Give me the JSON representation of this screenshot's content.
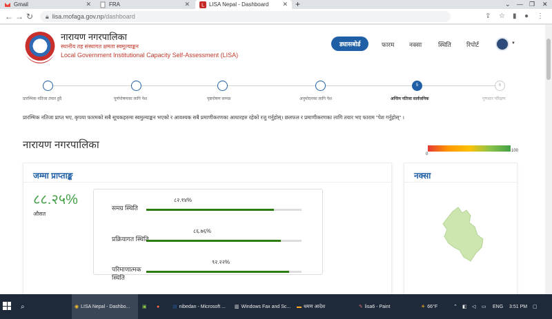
{
  "browser": {
    "tabs": [
      {
        "label": "Gmail",
        "icon": "gmail-icon",
        "active": false
      },
      {
        "label": "FRA",
        "icon": "document-icon",
        "active": false
      },
      {
        "label": "LISA Nepal - Dashboard",
        "icon": "lisa-icon",
        "active": true
      }
    ],
    "new_tab": "+",
    "url_host": "lisa.mofaga.gov.np",
    "url_path": "/dashboard"
  },
  "header": {
    "org_name": "नारायण नगरपालिका",
    "subtitle_np": "स्थानीय तह संस्थागत क्षमता स्वमूल्याङ्कन",
    "subtitle_en": "Local Government Institutional Capacity Self-Assessment (LISA)",
    "menu": {
      "dashboard": "ड्यासबोर्ड",
      "forms": "फारम",
      "map": "नक्सा",
      "status": "स्थिति",
      "report": "रिपोर्ट"
    }
  },
  "stepper": {
    "steps": [
      {
        "label": "प्रारम्भिक नतिजा तयार हुदै",
        "number": ""
      },
      {
        "label": "पूर्णपोषणका लागि पेश",
        "number": ""
      },
      {
        "label": "पृष्ठपोषण सम्पन्न",
        "number": ""
      },
      {
        "label": "अनुमोदनका लागि पेश",
        "number": ""
      },
      {
        "label": "अन्तिम नतिजा सार्वजनिक",
        "number": "5"
      },
      {
        "label": "गुणस्तर परिक्षण",
        "number": "6"
      }
    ]
  },
  "notice": "प्रारम्भिक नतिजा प्राप्त भए, कृपया फारमको सबै सूचकहरुमा स्वमुल्याङ्कन भएको र आवश्यक सबै प्रमाणीकरणका आधारहरु रहेको रजु गर्नुहोस्। छलफल र प्रमाणीकरणका लागि तयार भए फाराम \"पेश गर्नुहोस्\" ।",
  "section_title": "नारायण नगरपालिका",
  "scale": {
    "min": "0",
    "max": "100"
  },
  "score_card": {
    "title": "जम्मा प्राप्ताङ्क",
    "score": "८८.२५%",
    "avg_label": "औसत",
    "bars": [
      {
        "label": "समग्र स्थिति",
        "value_text": "८२.१४%",
        "value": 82.14
      },
      {
        "label": "प्रक्रियागत स्थिति",
        "value_text": "८६.७६%",
        "value": 86.76
      },
      {
        "label": "परिमाणात्मक स्थिति",
        "value_text": "९२.२२%",
        "value": 92.22
      }
    ]
  },
  "map_card": {
    "title": "नक्सा"
  },
  "taskbar": {
    "items": [
      {
        "label": "LISA Nepal - Dashbo...",
        "active": true
      },
      {
        "label": "",
        "active": false
      },
      {
        "label": "",
        "active": false
      },
      {
        "label": "nibedan - Microsoft ...",
        "active": false
      },
      {
        "label": "Windows Fax and Sc...",
        "active": false
      },
      {
        "label": "धमण आदेश",
        "active": false
      },
      {
        "label": "lisa6 - Paint",
        "active": false
      }
    ],
    "weather": "66°F",
    "lang": "ENG",
    "time": "3:51 PM"
  }
}
